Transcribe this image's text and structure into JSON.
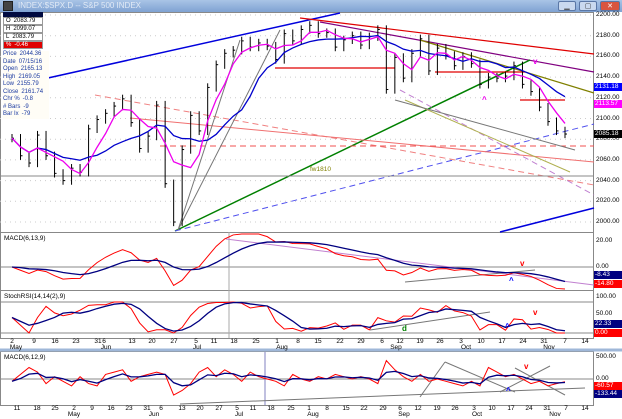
{
  "window": {
    "title": "INDEX:$SPX.D -- S&P 500 INDEX",
    "minimize": "▁",
    "maximize": "▢",
    "close": "✕"
  },
  "ohlc": {
    "open": "2083.79",
    "high": "2099.07",
    "low": "2083.79",
    "change_pct": "-0.46",
    "o": "O",
    "h": "H",
    "l": "L",
    "p": "%"
  },
  "details": [
    {
      "k": "Price",
      "v": "2044.36"
    },
    {
      "k": "Date",
      "v": "07/15/16"
    },
    {
      "k": "Open",
      "v": "2165.13"
    },
    {
      "k": "High",
      "v": "2169.05"
    },
    {
      "k": "Low",
      "v": "2155.79"
    },
    {
      "k": "Close",
      "v": "2161.74"
    },
    {
      "k": "Chr %",
      "v": "-0.8"
    },
    {
      "k": "# Bars",
      "v": "-9"
    },
    {
      "k": "Bar Ix",
      "v": "-79"
    }
  ],
  "colors": {
    "price": "#000000",
    "ma_long": "#0000cc",
    "ma_short": "#ee00ee",
    "macd": "#ff0000",
    "signal": "#000080"
  },
  "chart_data": [
    {
      "type": "line",
      "title": "S&P 500 INDEX daily bars",
      "x_dates": "2016-05-02 to 2016-11-04 (sampled every 2 trading days)",
      "close": [
        2081,
        2064,
        2057,
        2084,
        2064,
        2047,
        2040,
        2052,
        2048,
        2090,
        2099,
        2105,
        2112,
        2119,
        2096,
        2071,
        2083,
        2113,
        2037,
        2000,
        2070,
        2103,
        2088,
        2130,
        2152,
        2163,
        2166,
        2175,
        2169,
        2173,
        2170,
        2157,
        2182,
        2175,
        2186,
        2190,
        2182,
        2183,
        2169,
        2176,
        2180,
        2171,
        2179,
        2186,
        2128,
        2159,
        2139,
        2163,
        2177,
        2146,
        2168,
        2161,
        2151,
        2160,
        2153,
        2133,
        2140,
        2139,
        2141,
        2151,
        2133,
        2126,
        2111,
        2097,
        2088,
        2085
      ],
      "ylim": [
        2000,
        2200
      ],
      "yticks": [
        "2200.00",
        "2180.00",
        "2160.00",
        "2140.00",
        "2120.00",
        "2100.00",
        "2080.00",
        "2060.00",
        "2040.00",
        "2020.00",
        "2000.00"
      ],
      "last_values": {
        "ma_long": "2131.18",
        "ma_short": "2113.57",
        "price": "2085.18"
      },
      "annotations": {
        "fw": "fw1810",
        "sell": "v",
        "buy": "^"
      }
    },
    {
      "type": "line",
      "title": "MACD(6,13,9)",
      "yticks": [
        "20.00",
        "0.00"
      ],
      "last_values": {
        "signal": "-8.43",
        "macd": "-14.80"
      },
      "annotations": {
        "sell": "v",
        "buy": "^"
      }
    },
    {
      "type": "line",
      "title": "StochRSI(14,14(2),9)",
      "yticks": [
        "100.00",
        "50.00"
      ],
      "last_values": {
        "d": "22.33",
        "k": "0.00"
      },
      "annotations": {
        "sell": "v",
        "buy": "^",
        "d": "d"
      }
    },
    {
      "type": "line",
      "title": "MACD(6,12,9)",
      "yticks": [
        "500.00",
        "0.00"
      ],
      "last_values": {
        "macd": "-60.57",
        "signal": "-133.44"
      },
      "values": [
        -50,
        100,
        250,
        150,
        -100,
        50,
        -50,
        -150,
        50,
        -100,
        -150,
        100,
        150,
        200,
        -50,
        50,
        100,
        150,
        100,
        -350,
        -250,
        -100,
        150,
        250,
        50,
        200,
        100,
        -50,
        150,
        50,
        0,
        -50,
        -150,
        100,
        0,
        -50,
        50,
        0,
        100,
        50,
        0,
        50,
        0,
        -100,
        400,
        200,
        50,
        -50,
        100,
        -50,
        0,
        -50,
        -100,
        -150,
        -50,
        -150,
        250,
        150,
        50,
        100,
        0,
        -100,
        -50,
        -150,
        -100,
        -60
      ],
      "annotations": {
        "sell": "v",
        "buy": "^"
      }
    }
  ],
  "xaxis_top": {
    "days": [
      "2",
      "9",
      "16",
      "23",
      "31",
      "6",
      "13",
      "20",
      "27",
      "5",
      "11",
      "18",
      "25",
      "1",
      "8",
      "15",
      "22",
      "29",
      "6",
      "12",
      "19",
      "26",
      "3",
      "10",
      "17",
      "24",
      "31",
      "7",
      "14"
    ],
    "months": [
      "May",
      "Jun",
      "Jul",
      "Aug",
      "Sep",
      "Oct",
      "Nov"
    ]
  },
  "xaxis_bottom": {
    "days": [
      "11",
      "18",
      "25",
      "2",
      "9",
      "16",
      "23",
      "31",
      "6",
      "13",
      "20",
      "27",
      "5",
      "11",
      "18",
      "25",
      "1",
      "8",
      "15",
      "22",
      "29",
      "6",
      "12",
      "19",
      "26",
      "3",
      "10",
      "17",
      "24",
      "31",
      "7",
      "14"
    ],
    "months": [
      "May",
      "Jun",
      "Jul",
      "Aug",
      "Sep",
      "Oct",
      "Nov"
    ]
  }
}
